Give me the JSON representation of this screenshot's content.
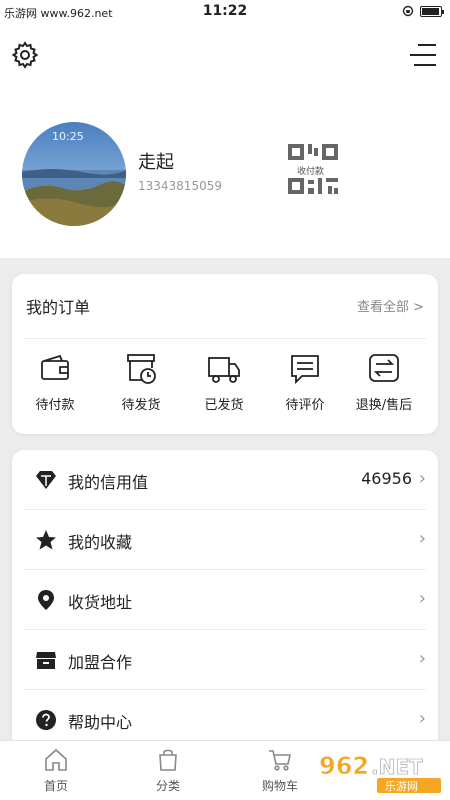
{
  "status_bar": {
    "site": "乐游网 www.962.net",
    "time": "11:22"
  },
  "profile": {
    "name": "走起",
    "phone": "13343815059",
    "qr_label": "收付款"
  },
  "orders": {
    "title": "我的订单",
    "view_all": "查看全部 >",
    "items": [
      {
        "label": "待付款",
        "icon": "wallet-icon"
      },
      {
        "label": "待发货",
        "icon": "package-clock-icon"
      },
      {
        "label": "已发货",
        "icon": "truck-icon"
      },
      {
        "label": "待评价",
        "icon": "comment-icon"
      },
      {
        "label": "退换/售后",
        "icon": "exchange-icon"
      }
    ]
  },
  "menu": [
    {
      "label": "我的信用值",
      "value": "46956",
      "icon": "diamond-icon"
    },
    {
      "label": "我的收藏",
      "icon": "star-icon"
    },
    {
      "label": "收货地址",
      "icon": "location-pin-icon"
    },
    {
      "label": "加盟合作",
      "icon": "store-icon"
    },
    {
      "label": "帮助中心",
      "icon": "help-icon"
    }
  ],
  "tabs": [
    {
      "label": "首页",
      "icon": "home-icon"
    },
    {
      "label": "分类",
      "icon": "bag-icon"
    },
    {
      "label": "购物车",
      "icon": "cart-icon"
    }
  ],
  "watermark": {
    "text_top": "962",
    "text_net": ".NET",
    "text_cn": "乐游网"
  },
  "colors": {
    "accent": "#222222",
    "muted": "#999999",
    "background": "#ececec",
    "watermark_orange": "#f5a623"
  }
}
